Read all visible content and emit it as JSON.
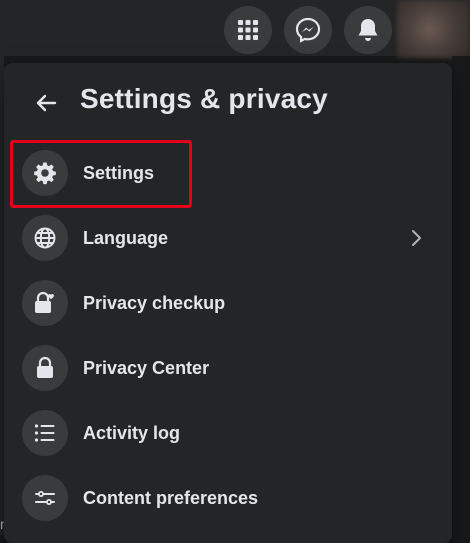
{
  "topbar": {
    "icons": [
      "menu-grid-icon",
      "messenger-icon",
      "notifications-bell-icon"
    ]
  },
  "panel": {
    "title": "Settings & privacy",
    "back_icon": "back-arrow-icon"
  },
  "menu": {
    "items": [
      {
        "label": "Settings",
        "icon": "gear-icon"
      },
      {
        "label": "Language",
        "icon": "globe-icon",
        "has_submenu": true
      },
      {
        "label": "Privacy checkup",
        "icon": "lock-heart-icon"
      },
      {
        "label": "Privacy Center",
        "icon": "lock-icon"
      },
      {
        "label": "Activity log",
        "icon": "list-icon"
      },
      {
        "label": "Content preferences",
        "icon": "sliders-icon"
      }
    ]
  },
  "annotation": {
    "highlight_color": "#e3001b",
    "highlighted_item": "Settings"
  },
  "background": {
    "edge_text": "n"
  },
  "colors": {
    "page_bg": "#18191a",
    "panel_bg": "#242526",
    "icon_bg": "#3a3b3c",
    "text": "#e4e6eb"
  }
}
